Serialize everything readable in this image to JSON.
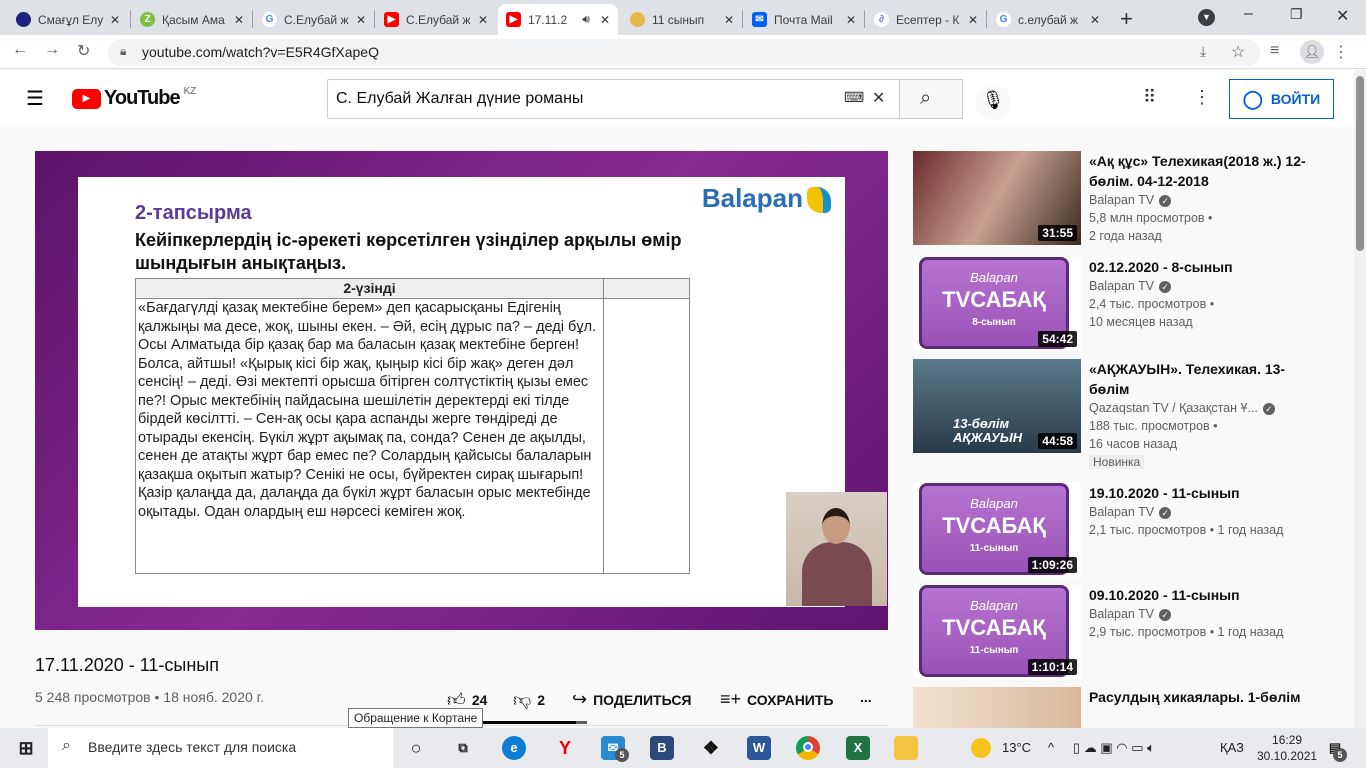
{
  "browser": {
    "tabs": [
      {
        "label": "Смағұл Елу",
        "color": "#1a237e"
      },
      {
        "label": "Қасым Ама",
        "color": "#7cc242"
      },
      {
        "label": "С.Елубай ж",
        "color": "#4285f4"
      },
      {
        "label": "С.Елубай ж",
        "color": "#ff0000"
      },
      {
        "label": "17.11.2",
        "color": "#ff0000"
      },
      {
        "label": "11 сынып",
        "color": "#e6b84a"
      },
      {
        "label": "Почта Mail",
        "color": "#005ff9"
      },
      {
        "label": "Есептер - К",
        "color": "#7a6ad0"
      },
      {
        "label": "с.елубай ж",
        "color": "#4285f4"
      }
    ],
    "url": "youtube.com/watch?v=E5R4GfXapeQ"
  },
  "youtube": {
    "logo": "YouTube",
    "region": "KZ",
    "search_value": "С. Елубай Жалған дүние романы",
    "login": "ВОЙТИ"
  },
  "slide": {
    "brand": "Balapan",
    "heading": "2-тапсырма",
    "task": "Кейіпкерлердің іс-әрекеті көрсетілген үзінділер арқылы өмір шындығын анықтаңыз.",
    "column": "2-үзінді",
    "excerpt": "«Бағдагүлді қазақ мектебіне берем» деп қасарысқаны Едігенің қалжыңы ма десе, жоқ, шыны екен. – Әй, есің дұрыс па? – деді бұл. Осы Алматыда бір қазақ бар ма баласын қазақ мектебіне берген! Болса, айтшы! «Қырық кісі бір жақ, қыңыр кісі бір жақ» деген дәл сенсің! – деді. Өзі мектепті орысша бітірген солтүстіктің қызы емес пе?! Орыс мектебінің пайдасына шешілетін деректерді екі тілде бірдей көсілтті. – Сен-ақ осы қара аспанды жерге төндіреді де отырады екенсің. Бүкіл жұрт ақымақ па, сонда? Сенен де ақылды, сенен де атақты жұрт бар емес пе? Солардың қайсысы балаларын қазақша оқытып жатыр? Сенікі не осы, бүйректен сирақ шығарып! Қазір қалаңда да, далаңда да бүкіл жұрт баласын орыс мектебінде оқытады. Одан олардың еш нәрсесі кеміген жоқ."
  },
  "video": {
    "title": "17.11.2020 - 11-сынып",
    "views": "5 248 просмотров • 18 нояб. 2020 г.",
    "likes": "24",
    "dislikes": "2",
    "share": "ПОДЕЛИТЬСЯ",
    "save": "СОХРАНИТЬ",
    "more": "..."
  },
  "tooltip": "Обращение к Кортане",
  "related": [
    {
      "title": "«Ақ құс» Телехикая(2018 ж.) 12-бөлім. 04-12-2018",
      "channel": "Balapan TV",
      "views": "5,8 млн просмотров •",
      "age": "2 года назад",
      "duration": "31:55"
    },
    {
      "title": "02.12.2020 - 8-сынып",
      "channel": "Balapan TV",
      "views": "2,4 тыс. просмотров •",
      "age": "10 месяцев назад",
      "duration": "54:42",
      "thumb_brand": "Balapan",
      "thumb_tv": "TVСАБАҚ",
      "thumb_class": "8-сынып"
    },
    {
      "title": "«АҚЖАУЫН». Телехикая. 13-бөлім",
      "channel": "Qazaqstan TV / Қазақстан Ұ...",
      "views": "188 тыс. просмотров •",
      "age": "16 часов назад",
      "duration": "44:58",
      "badge": "Новинка",
      "thumb_text": "13-бөлім АҚЖАУЫН"
    },
    {
      "title": "19.10.2020 - 11-сынып",
      "channel": "Balapan TV",
      "views": "2,1 тыс. просмотров • 1 год назад",
      "duration": "1:09:26",
      "thumb_brand": "Balapan",
      "thumb_tv": "TVСАБАҚ",
      "thumb_class": "11-сынып"
    },
    {
      "title": "09.10.2020 - 11-сынып",
      "channel": "Balapan TV",
      "views": "2,9 тыс. просмотров • 1 год назад",
      "duration": "1:10:14",
      "thumb_brand": "Balapan",
      "thumb_tv": "TVСАБАҚ",
      "thumb_class": "11-сынып"
    },
    {
      "title": "Расулдың хикаялары. 1-бөлім"
    }
  ],
  "taskbar": {
    "search_placeholder": "Введите здесь текст для поиска",
    "weather": "13°C",
    "lang": "ҚАЗ",
    "time": "16:29",
    "date": "30.10.2021",
    "notif": "5",
    "mail_badge": "5"
  }
}
